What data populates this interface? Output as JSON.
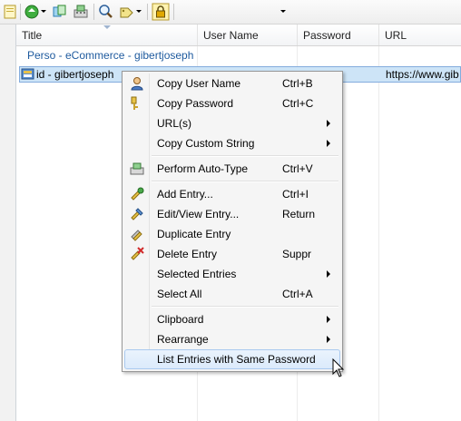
{
  "toolbar": {
    "items": [
      "new-database-icon",
      "sync-icon",
      "copy-entries-icon",
      "auto-type-icon",
      "find-icon",
      "tag-filter-icon",
      "lock-workspace-icon",
      "quick-search-dropdown"
    ]
  },
  "columns": [
    "Title",
    "User Name",
    "Password",
    "URL"
  ],
  "group_path": "Perso - eCommerce - gibertjoseph",
  "entry": {
    "title": "id - gibertjoseph",
    "url": "https://www.gib"
  },
  "context_menu": {
    "items": [
      {
        "label": "Copy User Name",
        "shortcut": "Ctrl+B",
        "icon": "user-icon"
      },
      {
        "label": "Copy Password",
        "shortcut": "Ctrl+C",
        "icon": "key-icon"
      },
      {
        "label": "URL(s)",
        "submenu": true
      },
      {
        "label": "Copy Custom String",
        "submenu": true
      },
      {
        "label": "Perform Auto-Type",
        "shortcut": "Ctrl+V",
        "icon": "auto-type-icon"
      },
      {
        "label": "Add Entry...",
        "shortcut": "Ctrl+I",
        "icon": "add-key-icon"
      },
      {
        "label": "Edit/View Entry...",
        "shortcut": "Return",
        "icon": "edit-key-icon"
      },
      {
        "label": "Duplicate Entry",
        "icon": "duplicate-key-icon"
      },
      {
        "label": "Delete Entry",
        "shortcut": "Suppr",
        "icon": "delete-key-icon"
      },
      {
        "label": "Selected Entries",
        "submenu": true
      },
      {
        "label": "Select All",
        "shortcut": "Ctrl+A"
      },
      {
        "label": "Clipboard",
        "submenu": true
      },
      {
        "label": "Rearrange",
        "submenu": true
      },
      {
        "label": "List Entries with Same Password",
        "highlighted": true
      }
    ]
  },
  "colors": {
    "selection": "#cde4f7",
    "group_text": "#1e5a9e",
    "menu_highlight": "#dbeafb"
  }
}
